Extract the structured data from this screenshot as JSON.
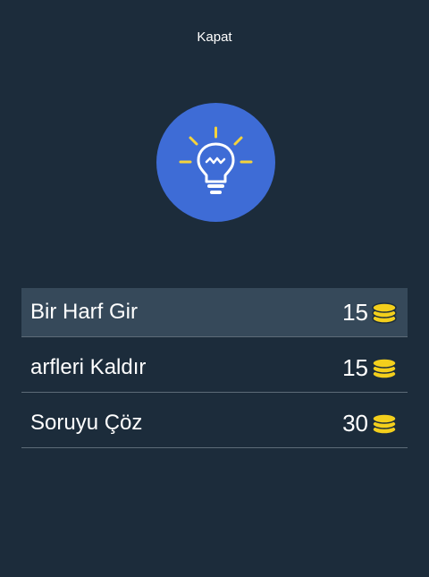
{
  "header": {
    "close_label": "Kapat"
  },
  "hint_icon": {
    "name": "lightbulb-icon",
    "background_color": "#3e6cd6",
    "ray_color": "#f5d33b"
  },
  "options": [
    {
      "label": "Bir Harf Gir",
      "cost": "15",
      "icon": "coins-icon"
    },
    {
      "label": "arfleri Kaldır",
      "cost": "15",
      "icon": "coins-icon"
    },
    {
      "label": "Soruyu Çöz",
      "cost": "30",
      "icon": "coins-icon"
    }
  ],
  "colors": {
    "background": "#1c2c3b",
    "selected_row": "#36495a",
    "coin": "#f3cf1c"
  }
}
